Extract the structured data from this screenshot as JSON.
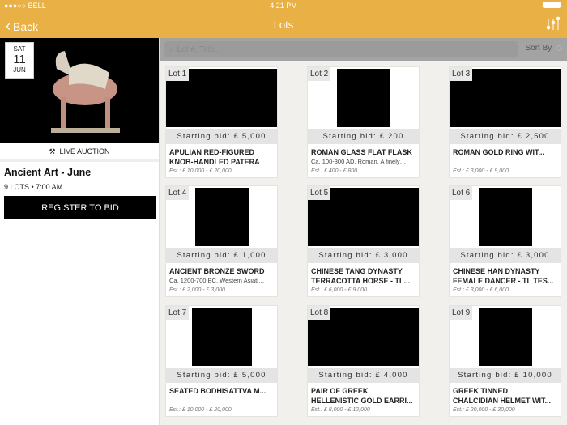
{
  "status": {
    "carrier": "●●●○○ BELL",
    "time": "4:21 PM"
  },
  "nav": {
    "back": "Back",
    "title": "Lots"
  },
  "sale": {
    "day": "SAT",
    "date": "11",
    "month": "JUN",
    "badge": "LIVE AUCTION",
    "title": "Ancient Art - June",
    "meta": "9 LOTS • 7:00 AM",
    "register": "REGISTER TO BID"
  },
  "search": {
    "placeholder": "Lot #, Title...",
    "sort": "Sort By"
  },
  "colors": {
    "brand": "#e8b045"
  },
  "lots": [
    {
      "lot": "Lot 1",
      "bid": "Starting bid: £ 5,000",
      "title": "APULIAN RED-FIGURED\nKNOB-HANDLED PATERA",
      "desc": "",
      "est": "Est.: £ 10,000 - £ 20,000"
    },
    {
      "lot": "Lot 2",
      "bid": "Starting bid: £ 200",
      "title": "ROMAN GLASS FLAT FLASK",
      "desc": "Ca. 100-300 AD. Roman. A finely…",
      "est": "Est.: £ 400 - £ 800"
    },
    {
      "lot": "Lot 3",
      "bid": "Starting bid: £ 2,500",
      "title": "ROMAN GOLD RING WIT...",
      "desc": "",
      "est": "Est.: £ 3,000 - £ 9,000"
    },
    {
      "lot": "Lot 4",
      "bid": "Starting bid: £ 1,000",
      "title": "ANCIENT BRONZE SWORD",
      "desc": "Ca. 1200-700 BC. Western Asiati…",
      "est": "Est.: £ 2,000 - £ 3,000"
    },
    {
      "lot": "Lot 5",
      "bid": "Starting bid: £ 3,000",
      "title": "CHINESE TANG DYNASTY\nTERRACOTTA HORSE - TL...",
      "desc": "",
      "est": "Est.: £ 6,000 - £ 9,000"
    },
    {
      "lot": "Lot 6",
      "bid": "Starting bid: £ 3,000",
      "title": "CHINESE HAN DYNASTY\nFEMALE DANCER - TL TES...",
      "desc": "",
      "est": "Est.: £ 3,000 - £ 6,000"
    },
    {
      "lot": "Lot 7",
      "bid": "Starting bid: £ 5,000",
      "title": "SEATED BODHISATTVA M...",
      "desc": "",
      "est": "Est.: £ 10,000 - £ 20,000"
    },
    {
      "lot": "Lot 8",
      "bid": "Starting bid: £ 4,000",
      "title": "PAIR OF GREEK\nHELLENISTIC GOLD EARRI...",
      "desc": "",
      "est": "Est.: £ 8,000 - £ 12,000"
    },
    {
      "lot": "Lot 9",
      "bid": "Starting bid: £ 10,000",
      "title": "GREEK TINNED\nCHALCIDIAN HELMET WIT...",
      "desc": "",
      "est": "Est.: £ 20,000 - £ 30,000"
    }
  ]
}
